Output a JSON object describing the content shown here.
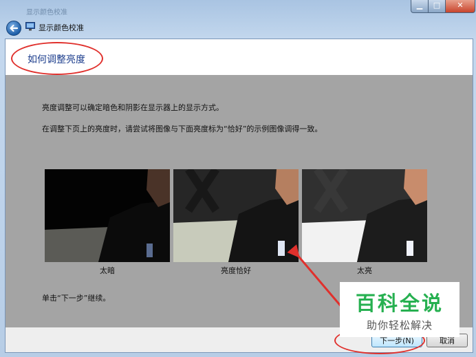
{
  "window": {
    "title": "显示颜色校准",
    "app_title": "显示颜色校准",
    "icons": [
      "back-arrow-icon",
      "display-monitor-icon",
      "minimize-icon",
      "maximize-icon",
      "close-icon"
    ]
  },
  "page": {
    "title": "如何调整亮度",
    "paragraph1": "亮度调整可以确定暗色和阴影在显示器上的显示方式。",
    "paragraph2": "在调整下页上的亮度时，请尝试将图像与下面亮度标为“恰好”的示例图像调得一致。",
    "instruction": "单击“下一步”继续。"
  },
  "samples": [
    {
      "label": "太暗"
    },
    {
      "label": "亮度恰好"
    },
    {
      "label": "太亮"
    }
  ],
  "buttons": {
    "next": "下一步(N)",
    "cancel": "取消"
  },
  "watermark": {
    "brand": "百科全说",
    "slogan": "助你轻松解决"
  },
  "colors": {
    "annotation": "#e0302c",
    "brand_green": "#26b050",
    "title_blue": "#1b3c8c"
  }
}
